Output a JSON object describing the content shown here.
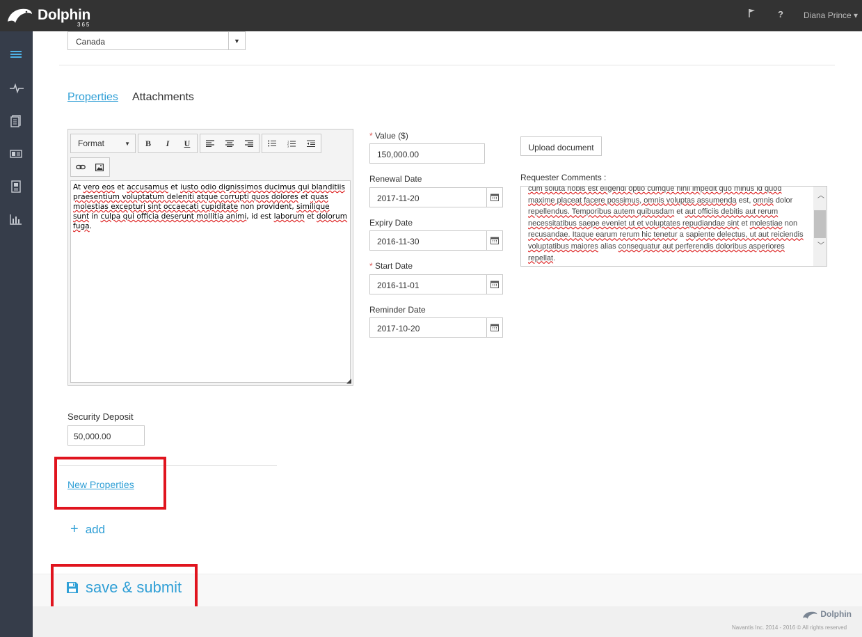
{
  "app": {
    "name": "Dolphin",
    "sub": "365",
    "user": "Diana Prince ▾"
  },
  "form": {
    "country": "Canada",
    "tabs": [
      "Properties",
      "Attachments"
    ],
    "editor": {
      "format_label": "Format",
      "content_html": "At <span class=\"sq\">vero eos</span> et <span class=\"sq\">accusamus</span> et <span class=\"sq\">iusto odio dignissimos ducimus qui blanditiis praesentium voluptatum deleniti atque corrupti quos dolores</span> et <span class=\"sq\">quas molestias excepturi sint occaecati cupiditate</span> non provident, <span class=\"sq\">similique sunt</span> in <span class=\"sq\">culpa qui officia deserunt mollitia animi</span>, id est <span class=\"sq\">laborum</span> et <span class=\"sq\">dolorum fuga</span>."
    },
    "value": {
      "label": "Value ($)",
      "value": "150,000.00"
    },
    "renewal_date": {
      "label": "Renewal Date",
      "value": "2017-11-20"
    },
    "expiry_date": {
      "label": "Expiry Date",
      "value": "2016-11-30"
    },
    "start_date": {
      "label": "Start Date",
      "value": "2016-11-01"
    },
    "reminder_date": {
      "label": "Reminder Date",
      "value": "2017-10-20"
    },
    "upload_label": "Upload document",
    "comments": {
      "label": "Requester Comments :",
      "text_html": "<span class=\"sq\">cum soluta nobis est eligendi optio cumque nihil impedit quo minus id quod</span><br><span class=\"sq\">maxime placeat facere possimus, omnis voluptas assumenda</span> est, <span class=\"sq\">omnis</span> dolor <span class=\"sq\">repellendus. Temporibus autem quibusdam</span> et <span class=\"sq\">aut officiis debitis aut rerum necessitatibus saepe eveniet ut et voluptates repudiandae sint</span> et <span class=\"sq\">molestiae</span> non <span class=\"sq\">recusandae. Itaque earum rerum hic tenetur</span> a <span class=\"sq\">sapiente delectus, ut aut reiciendis voluptatibus maiores</span> alias <span class=\"sq\">consequatur aut perferendis doloribus asperiores repellat</span>."
    },
    "security_deposit": {
      "label": "Security Deposit",
      "value": "50,000.00"
    },
    "new_properties": "New Properties",
    "add_label": "add",
    "save_label": "save & submit"
  },
  "footer": {
    "logo": "Dolphin",
    "copyright": "Navantis Inc. 2014 - 2016 © All rights reserved"
  },
  "colors": {
    "accent": "#2f9fd6",
    "highlight": "#e0141e",
    "topbar": "#333333",
    "sidebar": "#363d4a"
  }
}
